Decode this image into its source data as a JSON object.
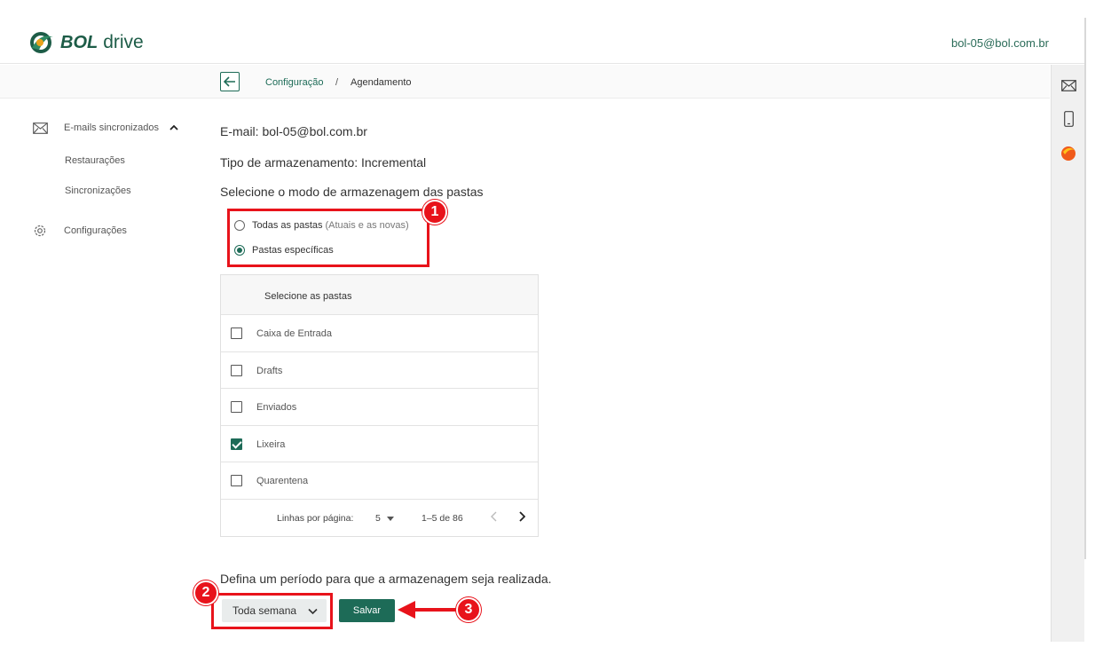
{
  "header": {
    "logo_bold": "BOL",
    "logo_rest": "drive",
    "user_email": "bol-05@bol.com.br"
  },
  "breadcrumb": {
    "back_icon": "arrow-left-icon",
    "parent": "Configuração",
    "separator": "/",
    "current": "Agendamento"
  },
  "sidebar": {
    "group_label": "E-mails sincronizados",
    "sub_items": [
      "Restaurações",
      "Sincronizações"
    ],
    "settings_label": "Configurações"
  },
  "main": {
    "email_line": "E-mail: bol-05@bol.com.br",
    "storage_type_line": "Tipo de armazenamento: Incremental",
    "mode_prompt": "Selecione o modo de armazenagem das pastas",
    "radio_all_label": "Todas as pastas",
    "radio_all_note": "(Atuais e as novas)",
    "radio_specific_label": "Pastas específicas",
    "selected_mode": "Pastas específicas",
    "period_prompt": "Defina um período para que a armazenagem seja realizada.",
    "period_value": "Toda semana",
    "save_label": "Salvar"
  },
  "table": {
    "header": "Selecione as pastas",
    "rows": [
      {
        "label": "Caixa de Entrada",
        "checked": false
      },
      {
        "label": "Drafts",
        "checked": false
      },
      {
        "label": "Enviados",
        "checked": false
      },
      {
        "label": "Lixeira",
        "checked": true
      },
      {
        "label": "Quarentena",
        "checked": false
      }
    ],
    "rows_per_page_label": "Linhas por página:",
    "rows_per_page_value": "5",
    "range_text": "1–5 de 86"
  },
  "annotations": {
    "step1": "1",
    "step2": "2",
    "step3": "3",
    "color": "#e8131b"
  },
  "colors": {
    "brand": "#1d6b57"
  }
}
